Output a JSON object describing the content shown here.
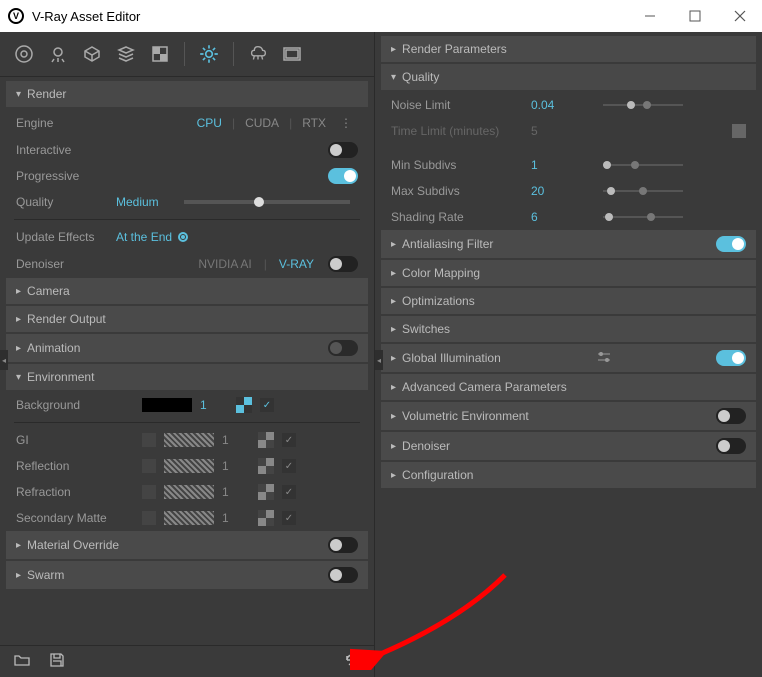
{
  "window": {
    "title": "V-Ray Asset Editor"
  },
  "left": {
    "render": {
      "title": "Render",
      "engine": {
        "label": "Engine",
        "options": [
          "CPU",
          "CUDA",
          "RTX"
        ],
        "selected": "CPU"
      },
      "interactive": {
        "label": "Interactive"
      },
      "progressive": {
        "label": "Progressive"
      },
      "quality": {
        "label": "Quality",
        "value": "Medium"
      },
      "update_effects": {
        "label": "Update Effects",
        "value": "At the End"
      },
      "denoiser": {
        "label": "Denoiser",
        "options": [
          "NVIDIA AI",
          "V-RAY"
        ],
        "selected": "V-RAY"
      }
    },
    "sections": {
      "camera": "Camera",
      "render_output": "Render Output",
      "animation": "Animation",
      "environment": "Environment",
      "material_override": "Material Override",
      "swarm": "Swarm"
    },
    "environment": {
      "background": {
        "label": "Background",
        "value": "1"
      },
      "gi": {
        "label": "GI",
        "value": "1"
      },
      "reflection": {
        "label": "Reflection",
        "value": "1"
      },
      "refraction": {
        "label": "Refraction",
        "value": "1"
      },
      "secondary_matte": {
        "label": "Secondary Matte",
        "value": "1"
      }
    }
  },
  "right": {
    "render_parameters": "Render Parameters",
    "quality": {
      "title": "Quality",
      "noise_limit": {
        "label": "Noise Limit",
        "value": "0.04"
      },
      "time_limit": {
        "label": "Time Limit (minutes)",
        "value": "5"
      },
      "min_subdivs": {
        "label": "Min Subdivs",
        "value": "1"
      },
      "max_subdivs": {
        "label": "Max Subdivs",
        "value": "20"
      },
      "shading_rate": {
        "label": "Shading Rate",
        "value": "6"
      }
    },
    "sections": {
      "antialiasing": "Antialiasing Filter",
      "color_mapping": "Color Mapping",
      "optimizations": "Optimizations",
      "switches": "Switches",
      "global_illum": "Global Illumination",
      "adv_camera": "Advanced Camera Parameters",
      "volumetric": "Volumetric Environment",
      "denoiser": "Denoiser",
      "configuration": "Configuration"
    }
  }
}
